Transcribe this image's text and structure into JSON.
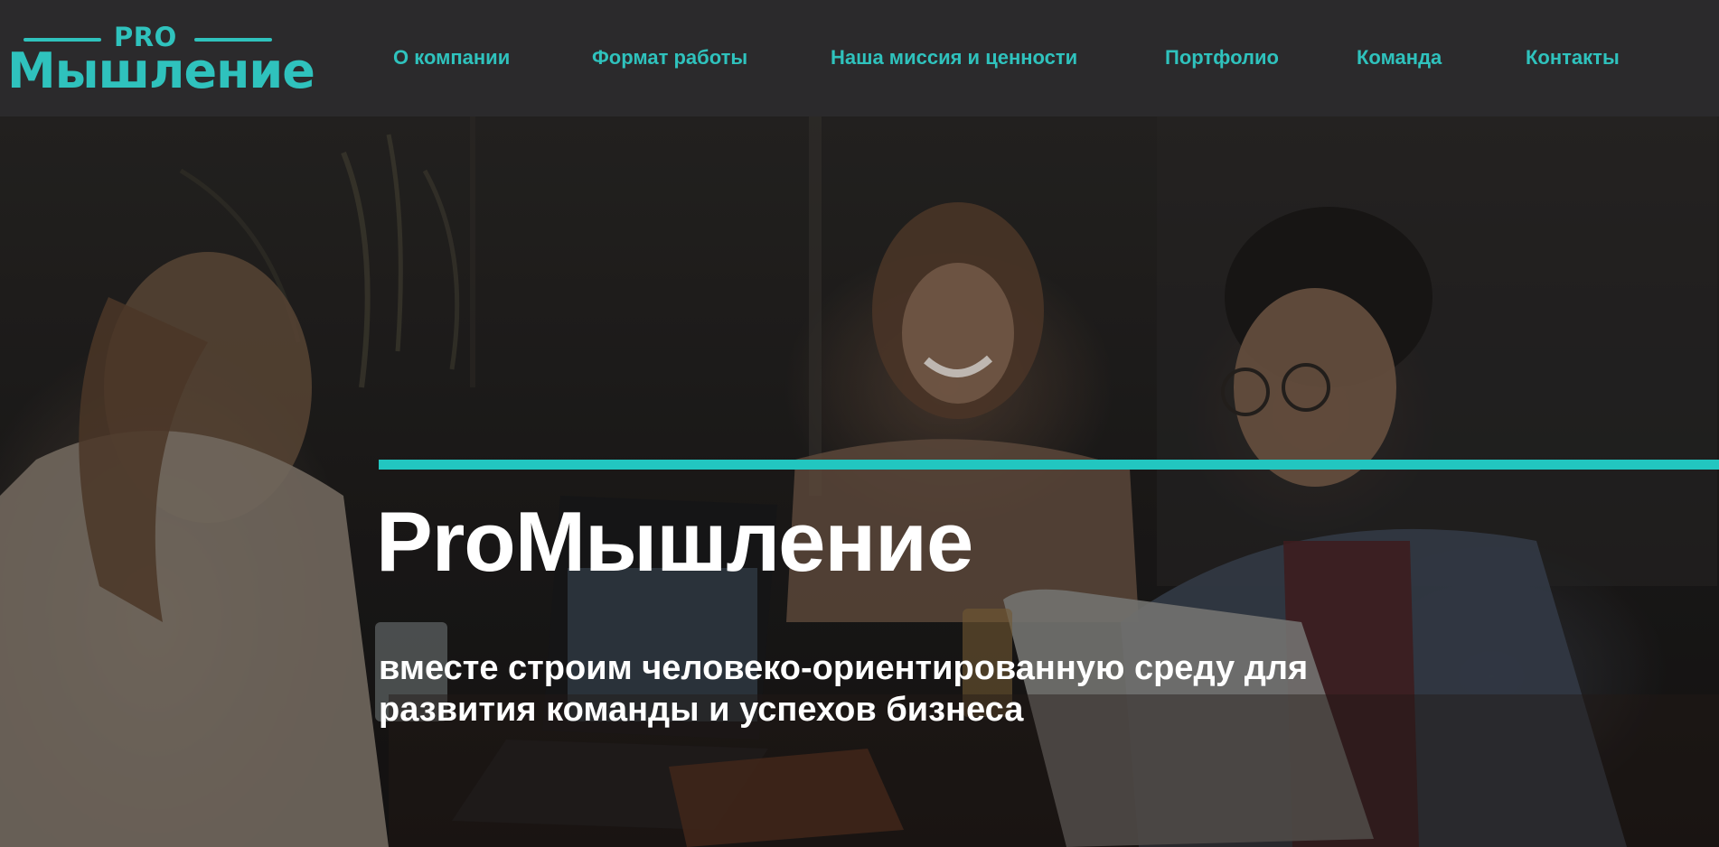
{
  "brand": {
    "logo_top": "PRO",
    "logo_main": "Мышление",
    "accent_color": "#2fc2bd"
  },
  "nav": {
    "items": [
      {
        "label": "О компании"
      },
      {
        "label": "Формат работы"
      },
      {
        "label": "Наша миссия и ценности"
      },
      {
        "label": "Портфолио"
      },
      {
        "label": "Команда"
      },
      {
        "label": "Контакты"
      }
    ]
  },
  "hero": {
    "title": "ProМышление",
    "subtitle": "вместе строим человеко-ориентированную среду для развития команды и успехов бизнеса",
    "background_image": "photo of three people laughing at a table with laptops",
    "bar_color": "#22c6c0"
  },
  "colors": {
    "header_bg": "#2b2a2c",
    "nav_text": "#2fc2bd",
    "hero_text": "#ffffff"
  }
}
